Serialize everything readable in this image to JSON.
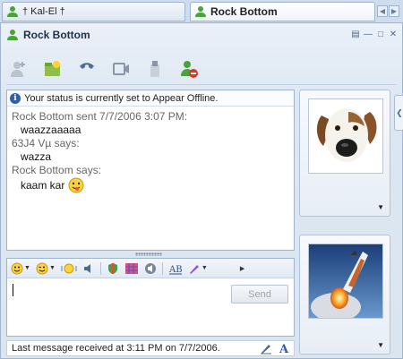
{
  "tabs": [
    {
      "label": "† Kal-El †",
      "active": false
    },
    {
      "label": "Rock Bottom",
      "active": true
    }
  ],
  "window": {
    "title": "Rock Bottom"
  },
  "toolbar": {
    "buttons": [
      "invite-icon",
      "send-files-icon",
      "call-icon",
      "video-icon",
      "activities-icon",
      "block-icon"
    ]
  },
  "history": {
    "status_notice": "Your status is currently set to Appear Offline.",
    "entries": [
      {
        "sender": "Rock Bottom sent 7/7/2006 3:07 PM:",
        "message": "waazzaaaaa"
      },
      {
        "sender": "63J4 Vµ says:",
        "message": "wazza"
      },
      {
        "sender": "Rock Bottom says:",
        "message": "kaam kar"
      }
    ]
  },
  "compose": {
    "send_label": "Send"
  },
  "status": {
    "last_message": "Last message received at 3:11 PM on 7/7/2006."
  },
  "colors": {
    "accent": "#2f5fa8",
    "buddy_green": "#4aa33a"
  }
}
